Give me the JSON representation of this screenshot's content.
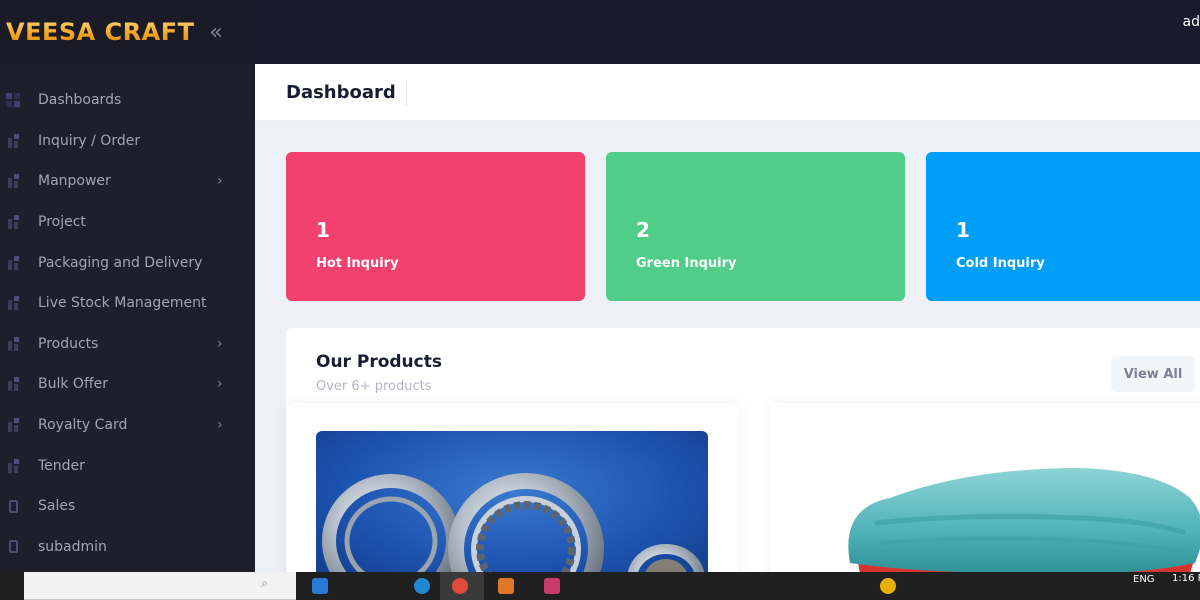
{
  "brand": {
    "name": "VEESA CRAFT",
    "collapse_glyph": "«"
  },
  "topbar": {
    "user_text": "ad"
  },
  "sidebar": {
    "items": [
      {
        "label": "Dashboards",
        "icon": "dashboard-icon",
        "has_submenu": false
      },
      {
        "label": "Inquiry / Order",
        "icon": "box-icon",
        "has_submenu": false
      },
      {
        "label": "Manpower",
        "icon": "box-icon",
        "has_submenu": true
      },
      {
        "label": "Project",
        "icon": "box-icon",
        "has_submenu": false
      },
      {
        "label": "Packaging and Delivery",
        "icon": "box-icon",
        "has_submenu": false
      },
      {
        "label": "Live Stock Management",
        "icon": "box-icon",
        "has_submenu": false
      },
      {
        "label": "Products",
        "icon": "box-icon",
        "has_submenu": true
      },
      {
        "label": "Bulk Offer",
        "icon": "box-icon",
        "has_submenu": true
      },
      {
        "label": "Royalty Card",
        "icon": "box-icon",
        "has_submenu": true
      },
      {
        "label": "Tender",
        "icon": "box-icon",
        "has_submenu": false
      },
      {
        "label": "Sales",
        "icon": "document-icon",
        "has_submenu": false
      },
      {
        "label": "subadmin",
        "icon": "document-icon",
        "has_submenu": false
      }
    ],
    "submenu_arrow": "›"
  },
  "subheader": {
    "title": "Dashboard"
  },
  "stats": [
    {
      "value": "1",
      "label": "Hot Inquiry",
      "color": "#f1416c"
    },
    {
      "value": "2",
      "label": "Green Inquiry",
      "color": "#50cd89"
    },
    {
      "value": "1",
      "label": "Cold Inquiry",
      "color": "#009ef7"
    }
  ],
  "products": {
    "title": "Our Products",
    "subtitle": "Over 6+ products",
    "view_all_label": "View All"
  },
  "taskbar": {
    "lang": "ENG",
    "time": "1:16 P"
  }
}
